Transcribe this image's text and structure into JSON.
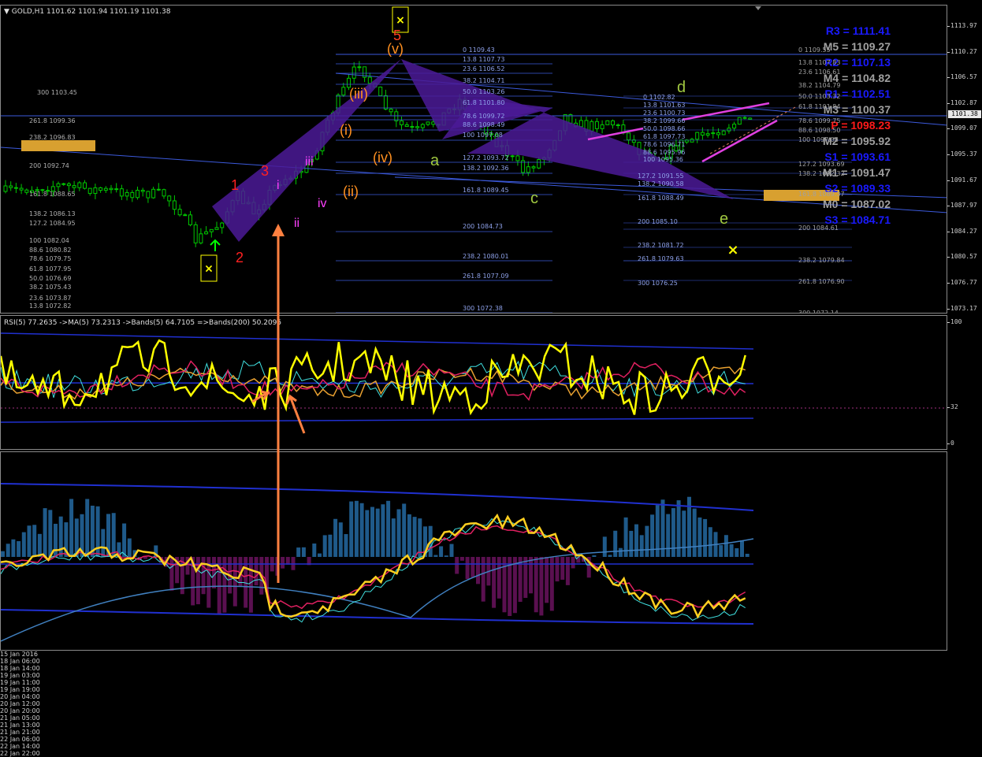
{
  "window": {
    "symbol_info": "GOLD,H1  1101.62 1101.94 1101.19 1101.38",
    "current_price": "1101.38"
  },
  "price_axis": [
    "1113.97",
    "1110.27",
    "1106.57",
    "1102.87",
    "1099.07",
    "1095.37",
    "1091.67",
    "1087.97",
    "1084.27",
    "1080.57",
    "1076.77",
    "1073.17"
  ],
  "rsi_axis": [
    "100",
    "32",
    "0"
  ],
  "rsi_info": "RSI(5) 77.2635   ->MA(5) 73.2313   ->Bands(5) 64.7105   =>Bands(200) 50.2095",
  "time_axis": [
    "15 Jan 2016",
    "18 Jan 06:00",
    "18 Jan 14:00",
    "19 Jan 03:00",
    "19 Jan 11:00",
    "19 Jan 19:00",
    "20 Jan 04:00",
    "20 Jan 12:00",
    "20 Jan 20:00",
    "21 Jan 05:00",
    "21 Jan 13:00",
    "21 Jan 21:00",
    "22 Jan 06:00",
    "22 Jan 14:00",
    "22 Jan 22:00"
  ],
  "pivots": [
    {
      "label": "R3 = 1111.41",
      "color": "#1a1aff"
    },
    {
      "label": "M5 = 1109.27",
      "color": "#a0a0a0"
    },
    {
      "label": "R2 = 1107.13",
      "color": "#1a1aff"
    },
    {
      "label": "M4 = 1104.82",
      "color": "#a0a0a0"
    },
    {
      "label": "R1 = 1102.51",
      "color": "#1a1aff"
    },
    {
      "label": "M3 = 1100.37",
      "color": "#a0a0a0"
    },
    {
      "label": "P   = 1098.23",
      "color": "#ff1a1a"
    },
    {
      "label": "M2 = 1095.92",
      "color": "#a0a0a0"
    },
    {
      "label": "S1 = 1093.61",
      "color": "#1a1aff"
    },
    {
      "label": "M1 = 1091.47",
      "color": "#a0a0a0"
    },
    {
      "label": "S2 = 1089.33",
      "color": "#1a1aff"
    },
    {
      "label": "M0 = 1087.02",
      "color": "#a0a0a0"
    },
    {
      "label": "S3 = 1084.71",
      "color": "#1a1aff"
    }
  ],
  "waves": {
    "impulse": [
      "1",
      "2",
      "3",
      "5"
    ],
    "minor": [
      "(i)",
      "(ii)",
      "(iii)",
      "(iv)",
      "(v)"
    ],
    "sub": [
      "i",
      "ii",
      "iii",
      "iv"
    ],
    "abcde": [
      "a",
      "c",
      "d",
      "e"
    ]
  },
  "fib_left": [
    "300 1103.45",
    "261.8 1099.36",
    "238.2 1096.83",
    "200 1092.74",
    "161.8 1088.65",
    "138.2 1086.13",
    "127.2 1084.95",
    "100 1082.04",
    "88.6 1080.82",
    "78.6 1079.75",
    "61.8 1077.95",
    "50.0 1076.69",
    "38.2 1075.43",
    "23.6 1073.87",
    "13.8 1072.82"
  ],
  "fib_mid": [
    "0 1109.43",
    "13.8 1107.73",
    "23.6 1106.52",
    "38.2 1104.71",
    "50.0 1103.26",
    "61.8 1101.80",
    "78.6 1099.72",
    "88.6 1098.49",
    "100 1097.08",
    "127.2 1093.72",
    "138.2 1092.36",
    "161.8 1089.45",
    "200 1084.73",
    "238.2 1080.01",
    "261.8 1077.09",
    "300 1072.38"
  ],
  "fib_mid2": [
    "0 1102.82",
    "13.8 1101.63",
    "23.6 1100.73",
    "38.2 1099.66",
    "50.0 1098.66",
    "61.8 1097.73",
    "78.6 1096.71",
    "88.6 1095.96",
    "100 1095.36",
    "127.2 1091.55",
    "138.2 1090.58",
    "161.8 1088.49",
    "200 1085.10",
    "238.2 1081.72",
    "261.8 1079.63",
    "300 1076.25"
  ],
  "fib_right": [
    "0 1109.55",
    "13.8 1107.83",
    "23.6 1106.61",
    "38.2 1104.79",
    "50.0 1103.32",
    "61.8 1101.84",
    "78.6 1099.75",
    "88.6 1098.50",
    "100 1097.08",
    "127.2 1093.69",
    "138.2 1092.32",
    "161.8 1089.37",
    "200 1084.61",
    "238.2 1079.84",
    "261.8 1076.90",
    "300 1072.14"
  ],
  "colors": {
    "bull": "#00c800",
    "bear": "#000000",
    "harmonic": "#5a1aa0",
    "rsi": "#ffff00",
    "histogram_pos": "#1f5a8a",
    "histogram_neg": "#5a1050",
    "arrow": "#ff8040"
  }
}
